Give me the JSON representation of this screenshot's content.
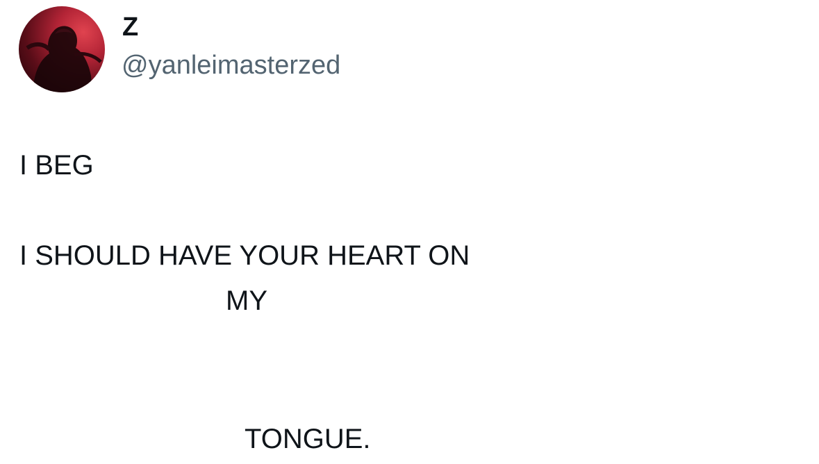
{
  "author": {
    "display_name": "Z",
    "handle": "@yanleimasterzed",
    "avatar_icon": "user-avatar-icon"
  },
  "tweet": {
    "lines": [
      "I BEG",
      "I SHOULD HAVE YOUR HEART ON",
      "MY",
      "TONGUE."
    ]
  },
  "colors": {
    "text_primary": "#0f1419",
    "text_secondary": "#536471",
    "background": "#ffffff",
    "avatar_accent": "#b32436"
  }
}
